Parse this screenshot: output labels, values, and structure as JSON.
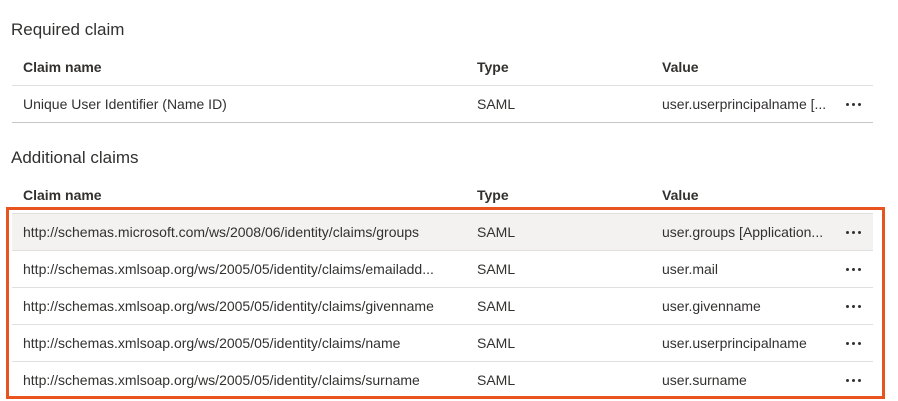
{
  "required": {
    "title": "Required claim",
    "headers": {
      "name": "Claim name",
      "type": "Type",
      "value": "Value"
    },
    "rows": [
      {
        "name": "Unique User Identifier (Name ID)",
        "type": "SAML",
        "value": "user.userprincipalname [..."
      }
    ]
  },
  "additional": {
    "title": "Additional claims",
    "headers": {
      "name": "Claim name",
      "type": "Type",
      "value": "Value"
    },
    "rows": [
      {
        "name": "http://schemas.microsoft.com/ws/2008/06/identity/claims/groups",
        "type": "SAML",
        "value": "user.groups [Application..."
      },
      {
        "name": "http://schemas.xmlsoap.org/ws/2005/05/identity/claims/emailadd...",
        "type": "SAML",
        "value": "user.mail"
      },
      {
        "name": "http://schemas.xmlsoap.org/ws/2005/05/identity/claims/givenname",
        "type": "SAML",
        "value": "user.givenname"
      },
      {
        "name": "http://schemas.xmlsoap.org/ws/2005/05/identity/claims/name",
        "type": "SAML",
        "value": "user.userprincipalname"
      },
      {
        "name": "http://schemas.xmlsoap.org/ws/2005/05/identity/claims/surname",
        "type": "SAML",
        "value": "user.surname"
      }
    ]
  },
  "icons": {
    "more": "more-options-icon"
  },
  "colors": {
    "highlight_box": "#e8541f",
    "selected_row": "#f3f2f1"
  }
}
